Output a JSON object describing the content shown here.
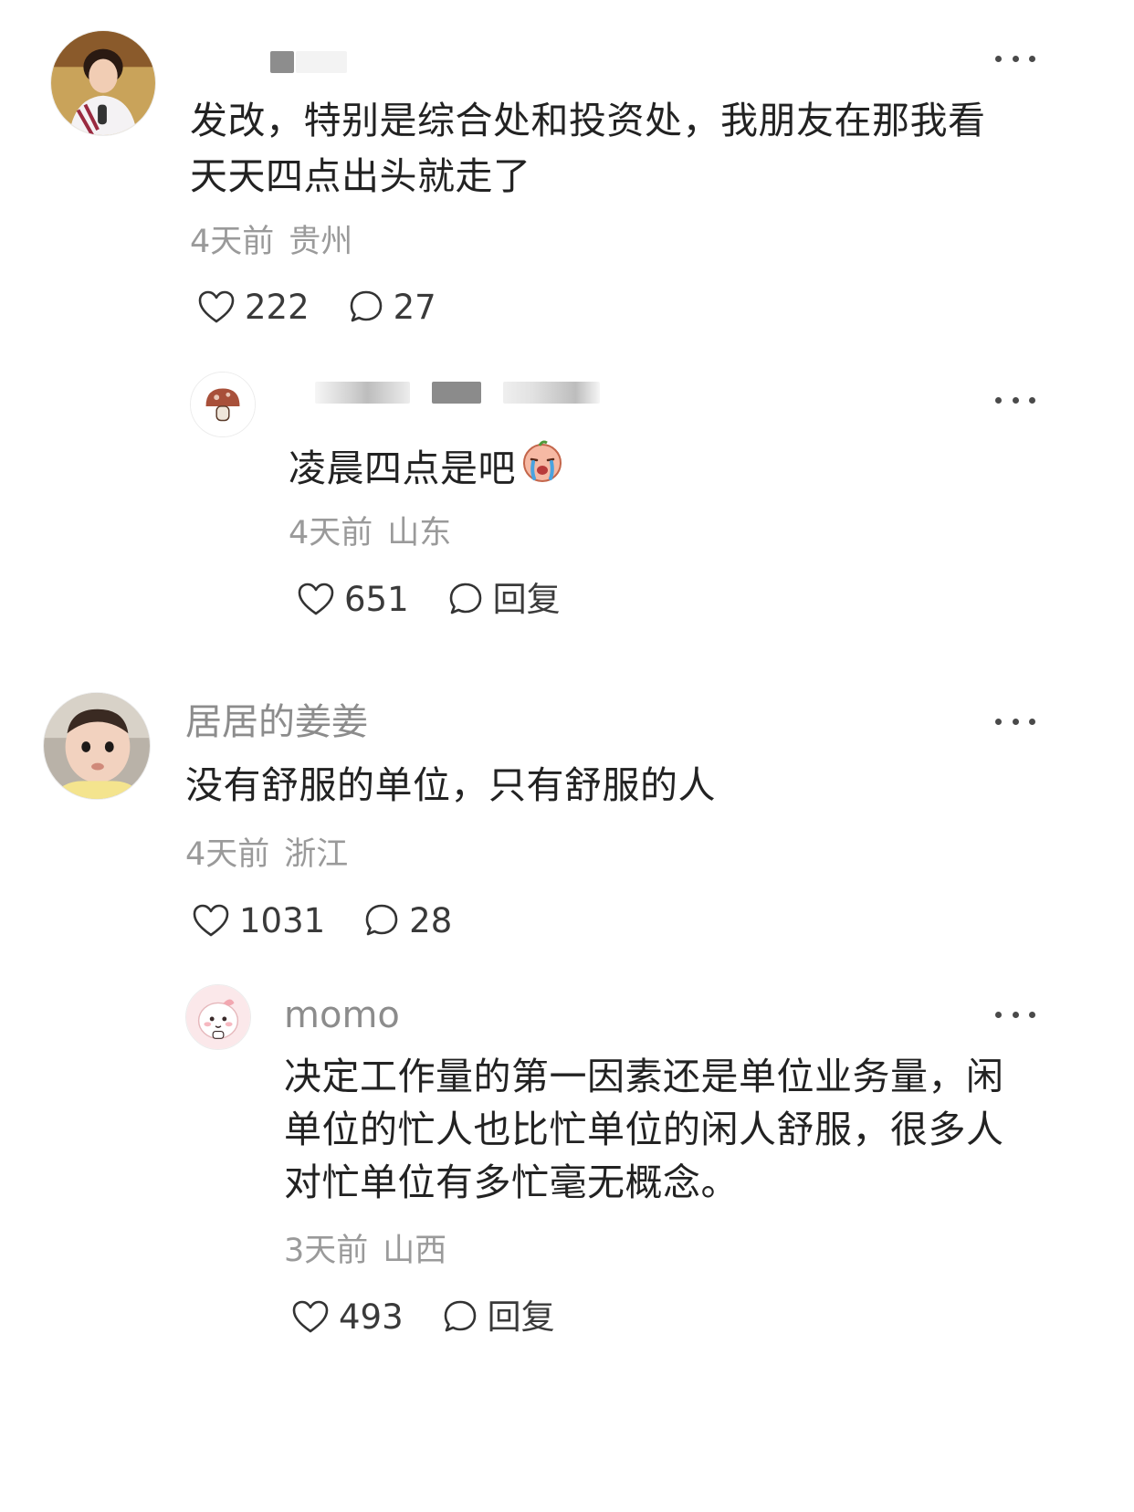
{
  "comments": [
    {
      "username": "",
      "text_lines": [
        "发改，特别是综合处和投资处，我朋友在那我看",
        "天天四点出头就走了"
      ],
      "time": "4天前",
      "location": "贵州",
      "likes": "222",
      "replies": "27",
      "reply_label": "",
      "avatar_icon": "woman-photo-avatar"
    },
    {
      "username": "",
      "text_lines": [
        "凌晨四点是吧"
      ],
      "emoji_icon": "crying-face-emoji",
      "time": "4天前",
      "location": "山东",
      "likes": "651",
      "replies": "",
      "reply_label": "回复",
      "avatar_icon": "mushroom-avatar"
    },
    {
      "username": "居居的姜姜",
      "text_lines": [
        "没有舒服的单位，只有舒服的人"
      ],
      "time": "4天前",
      "location": "浙江",
      "likes": "1031",
      "replies": "28",
      "reply_label": "",
      "avatar_icon": "baby-photo-avatar"
    },
    {
      "username": "momo",
      "text_lines": [
        "决定工作量的第一因素还是单位业务量，闲",
        "单位的忙人也比忙单位的闲人舒服，很多人",
        "对忙单位有多忙毫无概念。"
      ],
      "time": "3天前",
      "location": "山西",
      "likes": "493",
      "replies": "",
      "reply_label": "回复",
      "avatar_icon": "pink-character-avatar"
    }
  ],
  "icons": {
    "like": "heart-icon",
    "comment": "comment-bubble-icon",
    "more": "more-dots-icon"
  },
  "colors": {
    "text": "#222222",
    "meta": "#9a9a9a",
    "name": "#8c8c8c",
    "background": "#ffffff"
  }
}
